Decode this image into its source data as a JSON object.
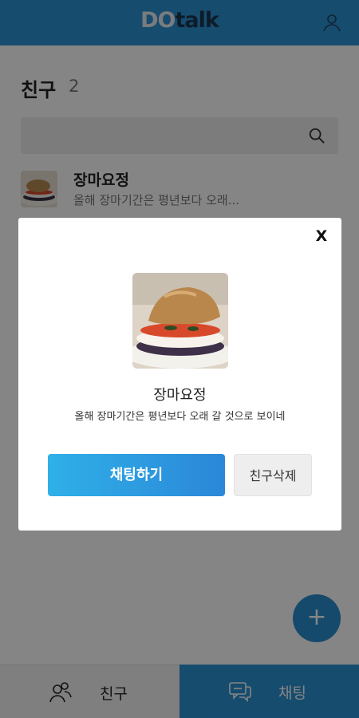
{
  "header": {
    "logo_part1": "DO",
    "logo_part2": "talk",
    "user_icon": "user-icon"
  },
  "friends": {
    "title": "친구",
    "count": "2",
    "search_icon": "search-icon",
    "list": [
      {
        "name": "장마요정",
        "status": "올해 장마기간은 평년보다 오래..."
      }
    ]
  },
  "fab": {
    "label": "+"
  },
  "bottom_nav": {
    "friends_label": "친구",
    "chat_label": "채팅"
  },
  "modal": {
    "close_label": "X",
    "name": "장마요정",
    "status": "올해 장마기간은 평년보다 오래 갈 것으로 보이네",
    "chat_button": "채팅하기",
    "delete_button": "친구삭제"
  },
  "colors": {
    "primary": "#2b92d4",
    "overlay": "rgba(0,0,0,0.48)"
  }
}
